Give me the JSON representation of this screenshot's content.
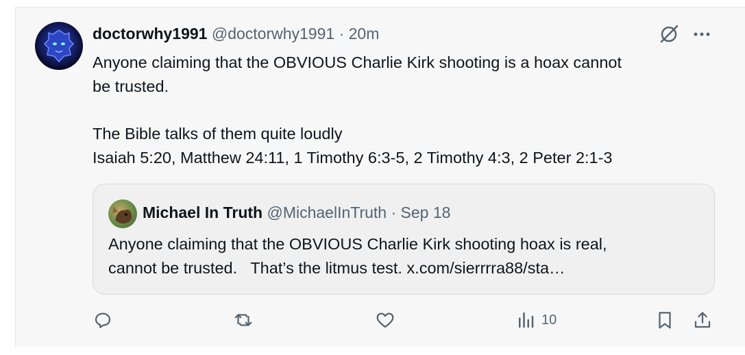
{
  "tweet": {
    "display_name": "doctorwhy1991",
    "handle": "@doctorwhy1991",
    "separator": " · ",
    "time": "20m",
    "text_lines": [
      "Anyone claiming that the OBVIOUS Charlie Kirk shooting is a hoax cannot",
      "be trusted.",
      "The Bible talks of them quite loudly",
      "Isaiah 5:20, Matthew 24:11, 1 Timothy 6:3-5, 2 Timothy 4:3, 2 Peter 2:1-3"
    ],
    "avatar_icon": "lion-avatar",
    "grok_icon": "grok-icon",
    "more_icon": "more-icon"
  },
  "quote": {
    "display_name": "Michael In Truth",
    "handle": "@MichaelInTruth",
    "separator": " · ",
    "date": "Sep 18",
    "text": "Anyone claiming that the OBVIOUS Charlie Kirk shooting hoax is real,\ncannot be trusted.   That’s the litmus test. x.com/sierrrra88/sta…",
    "avatar_icon": "dog-avatar"
  },
  "actions": {
    "reply_icon": "reply-icon",
    "retweet_icon": "retweet-icon",
    "like_icon": "like-icon",
    "views_icon": "views-icon",
    "views_count": "10",
    "bookmark_icon": "bookmark-icon",
    "share_icon": "share-icon"
  },
  "colors": {
    "text": "#0f1419",
    "muted": "#536471",
    "background": "#f7f7f7",
    "quote_border": "#d5dade"
  }
}
